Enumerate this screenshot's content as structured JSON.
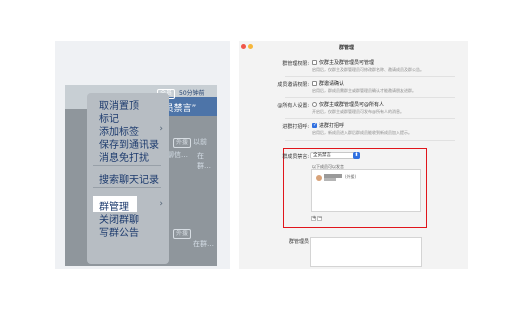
{
  "left": {
    "badge_top": "全员",
    "minutes": "50分钟前",
    "banner": "“全员禁言”",
    "tag1": "外援",
    "tag2": "外援",
    "faint1": "以前",
    "faint2": "群聊信…",
    "faint3": "在群…",
    "faint4": "@1",
    "faint5": "在群…",
    "menu_items": [
      "取消置顶",
      "标记",
      "添加标签",
      "保存到通讯录",
      "消息免打扰",
      "搜索聊天记录",
      "群管理",
      "关闭群聊",
      "写群公告"
    ],
    "menu_chevrons": [
      "›",
      "›"
    ]
  },
  "window": {
    "title": "群管理",
    "rows": [
      {
        "label": "群管理权限:",
        "option": "仅群主及群管理员可管理",
        "desc": "启用后，仅群主及群管理员可修改群名称、邀请成员及群公告。",
        "checked": false,
        "control": "checkbox"
      },
      {
        "label": "成员邀请权限:",
        "option": "群邀请确认",
        "desc": "启用后，群成员需群主或群管理员确认才能邀请朋友进群。",
        "checked": false,
        "control": "checkbox"
      },
      {
        "label": "@所有人设置:",
        "option": "仅群主或群管理员可@所有人",
        "desc": "开启后，仅群主或群管理员可发布@所有人的消息。",
        "checked": false,
        "control": "radio"
      },
      {
        "label": "进群打招呼:",
        "option": "进群打招呼",
        "desc": "启用后，新成员进入群后群成员能收到新成员加入提示。",
        "checked": true,
        "control": "checkbox"
      }
    ],
    "ban": {
      "label": "群成员禁言:",
      "select_value": "全员禁言",
      "select_arrow": "⬍",
      "allowed_label": "以下成员可以发言",
      "member_tag": "(外援)",
      "add": "+",
      "remove": "−"
    },
    "notice_label": "群管理员"
  }
}
